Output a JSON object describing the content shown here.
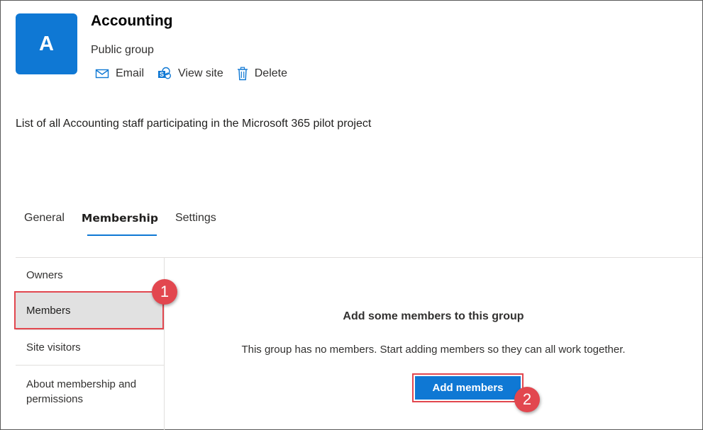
{
  "group": {
    "avatar_letter": "A",
    "name": "Accounting",
    "type": "Public group",
    "description": "List of all Accounting staff participating in the Microsoft 365 pilot project"
  },
  "actions": [
    {
      "label": "Email",
      "icon": "mail-icon"
    },
    {
      "label": "View site",
      "icon": "sharepoint-icon"
    },
    {
      "label": "Delete",
      "icon": "trash-icon"
    }
  ],
  "tabs": [
    {
      "label": "General",
      "active": false
    },
    {
      "label": "Membership",
      "active": true
    },
    {
      "label": "Settings",
      "active": false
    }
  ],
  "sidebar": {
    "items": [
      {
        "label": "Owners",
        "selected": false
      },
      {
        "label": "Members",
        "selected": true
      },
      {
        "label": "Site visitors",
        "selected": false
      },
      {
        "label": "About membership and permissions",
        "selected": false
      }
    ]
  },
  "main": {
    "empty_heading": "Add some members to this group",
    "empty_text": "This group has no members. Start adding members so they can all work together.",
    "add_button_label": "Add members"
  },
  "callouts": {
    "step1": "1",
    "step2": "2"
  },
  "colors": {
    "accent": "#0f78d4",
    "callout": "#e2474f"
  }
}
